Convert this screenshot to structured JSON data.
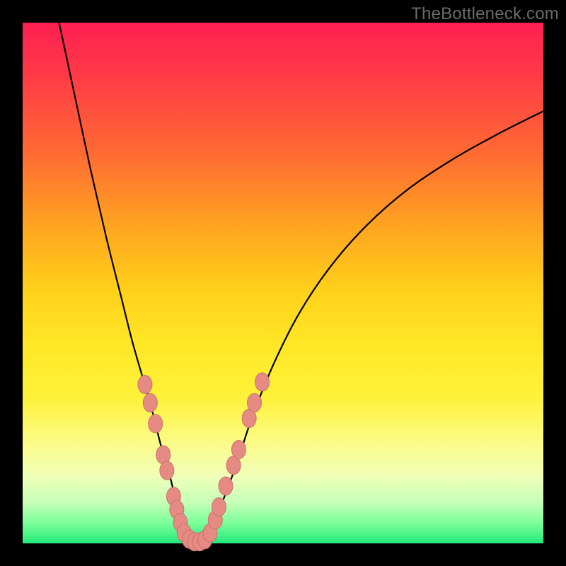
{
  "watermark": "TheBottleneck.com",
  "colors": {
    "frame": "#000000",
    "curve": "#000000",
    "marker_fill": "#e68a84",
    "marker_stroke": "#c9726c"
  },
  "chart_data": {
    "type": "line",
    "title": "",
    "xlabel": "",
    "ylabel": "",
    "xlim": [
      0,
      100
    ],
    "ylim": [
      0,
      100
    ],
    "grid": false,
    "series": [
      {
        "name": "bottleneck-curve",
        "x": [
          7,
          10,
          13,
          16,
          19,
          21,
          23,
          25,
          26.5,
          28,
          29.5,
          31,
          32.5,
          34,
          36,
          38,
          41,
          44,
          48,
          53,
          59,
          66,
          74,
          83,
          92,
          100
        ],
        "y": [
          100,
          86,
          72,
          59,
          47,
          39,
          32,
          25,
          19,
          14,
          8,
          3,
          0,
          0,
          2,
          7,
          15,
          24,
          34,
          44,
          53,
          61,
          68,
          74,
          79,
          83
        ]
      }
    ],
    "markers": {
      "name": "highlighted-points",
      "points": [
        {
          "x": 23.5,
          "y": 30.5
        },
        {
          "x": 24.5,
          "y": 27
        },
        {
          "x": 25.5,
          "y": 23
        },
        {
          "x": 27,
          "y": 17
        },
        {
          "x": 27.7,
          "y": 14
        },
        {
          "x": 29,
          "y": 9
        },
        {
          "x": 29.6,
          "y": 6.5
        },
        {
          "x": 30.3,
          "y": 4
        },
        {
          "x": 31,
          "y": 2
        },
        {
          "x": 32,
          "y": 0.8
        },
        {
          "x": 33,
          "y": 0.3
        },
        {
          "x": 34,
          "y": 0.3
        },
        {
          "x": 35,
          "y": 0.7
        },
        {
          "x": 36,
          "y": 2
        },
        {
          "x": 37,
          "y": 4.5
        },
        {
          "x": 37.7,
          "y": 7
        },
        {
          "x": 39,
          "y": 11
        },
        {
          "x": 40.5,
          "y": 15
        },
        {
          "x": 41.5,
          "y": 18
        },
        {
          "x": 43.5,
          "y": 24
        },
        {
          "x": 44.5,
          "y": 27
        },
        {
          "x": 46,
          "y": 31
        }
      ]
    }
  }
}
